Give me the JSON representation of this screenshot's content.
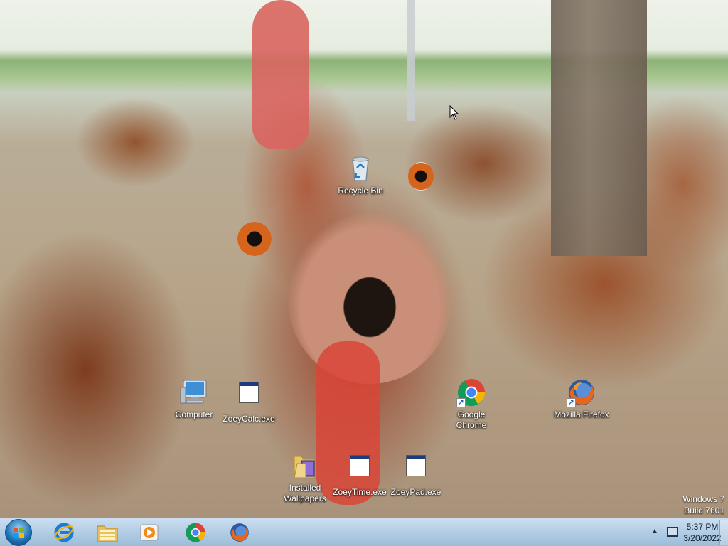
{
  "desktop": {
    "icons": {
      "recycle_bin": "Recycle Bin",
      "computer": "Computer",
      "zoeycalc": "ZoeyCalc.exe",
      "chrome": "Google Chrome",
      "firefox": "Mozilla Firefox",
      "wallpapers": "Installed Wallpapers",
      "zoeytime": "ZoeyTime.exe",
      "zoeypad": "ZoeyPad.exe"
    },
    "watermark": {
      "line1": "Windows 7",
      "line2": "Build 7601"
    }
  },
  "taskbar": {
    "pinned": [
      "internet-explorer-icon",
      "file-explorer-icon",
      "media-player-icon",
      "chrome-icon",
      "firefox-icon"
    ],
    "clock": {
      "time": "5:37 PM",
      "date": "3/20/2022"
    }
  },
  "colors": {
    "taskbar": "#a8c4de",
    "chrome_red": "#db4437",
    "chrome_green": "#0f9d58",
    "chrome_yellow": "#f4b400",
    "chrome_blue": "#4285f4",
    "firefox_orange": "#e8661c"
  }
}
